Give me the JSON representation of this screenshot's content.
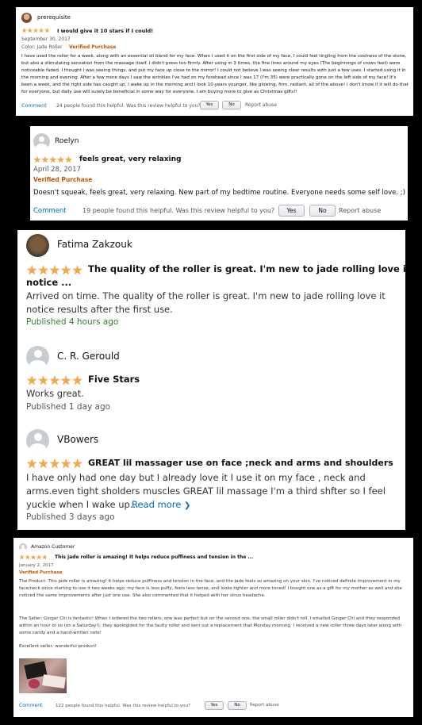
{
  "review1": {
    "author": "prerequisite",
    "title": "I would give it 10 stars if I could!",
    "date": "September 30, 2017",
    "variant": "Color: Jade Roller",
    "verified": "Verified Purchase",
    "body": "I have used the roller for a week, along with an essential oil blend for my face. When I used it on the first side of my face, I could feel tingling from the coolness of the stone, but also a stimulating sensation from the massage itself. I didn't press too firmly. After using in 3 times, the fine lines around my eyes (The beginnings of crows feet) were noticeable faded. I thought I was seeing things, and put my face up close to the mirror! I could not believe I was seeing clear results with just a few uses. I started using it in the morning and evening. After a few more days I saw the wrinkles I've had on my forehead since I was 17 (I'm 35) were practically gone on the left side of my face! It's been a week, and the right side has caught up. I wake up in the morning and I look 10 years younger, like glowing, firm, radiant, all of the above! I don't know if it will do that for everyone, but daily use will surely be beneficial in some way for everyone. I am buying more to give as Christmas gifts!!",
    "comment": "Comment",
    "helpful": "24 people found this helpful. Was this review helpful to you?",
    "yes": "Yes",
    "no": "No",
    "report": "Report abuse"
  },
  "review2": {
    "author": "Roelyn",
    "title": "feels great, very relaxing",
    "date": "April 28, 2017",
    "verified": "Verified Purchase",
    "body": "Doesn't squeak, feels great, very relaxing. New part of my bedtime routine. Everyone needs some self love. ;)",
    "comment": "Comment",
    "helpful": "19 people found this helpful. Was this review helpful to you?",
    "yes": "Yes",
    "no": "No",
    "report": "Report abuse"
  },
  "review3": {
    "author": "Fatima Zakzouk",
    "title_line1": "The quality of the roller is great. I'm new to jade rolling love it",
    "title_line2": "notice ...",
    "body_line1": "Arrived on time. The quality of the roller is great. I'm new to jade rolling love it",
    "body_line2": "notice results after the first use.",
    "published": "Published 4 hours ago"
  },
  "review4": {
    "author": "C. R. Gerould",
    "title": "Five Stars",
    "body": "Works great.",
    "published": "Published 1 day ago"
  },
  "review5": {
    "author": "VBowers",
    "title": "GREAT lil massager use on face ;neck and arms and shoulders",
    "body_line1": "I have only had one day but I already love it I use it on my face , neck and",
    "body_line2": "arms.even tight sholders muscles GREAT lil massage I'm a third shfter so I feel",
    "body_line3": "yuckie when I wake up...",
    "read_more": "Read more",
    "published": "Published 3 days ago"
  },
  "review6": {
    "author": "Amazon Customer",
    "title": "This jade roller is amazing! It helps reduce puffiness and tension in the ...",
    "date": "January 2, 2017",
    "verified": "Verified Purchase",
    "product_para": "The Product: This jade roller is amazing! It helps reduce puffiness and tension in the face, and the jade feels so amazing on your skin. I've noticed definite improvement in my face/neck since starting to use it two weeks ago; my face is less puffy, feels less tense, and looks tighter and more toned! I bought one as a gift for my mother as well and she noticed the same improvements after just one use. She also commented that it helped with her sinus headache.",
    "seller_para": "The Seller: Ginger Chi is fantastic! When I ordered the two rollers, one was perfect but on the second one, the small roller didn't roll. I emailed Ginger Chi and they responded within an hour or so (on a Saturday!); they apologized for the faulty roller and sent out a replacement that Monday morning. I received a new roller three days later along with some candy and a hand-written note!",
    "closing": "Excellent seller, wonderful product!",
    "comment": "Comment",
    "helpful": "122 people found this helpful. Was this review helpful to you?",
    "yes": "Yes",
    "no": "No",
    "report": "Report abuse"
  },
  "colors": {
    "star": "#f3a847",
    "verified": "#c45500",
    "published": "#2f7d2f",
    "link": "#0066c0"
  }
}
